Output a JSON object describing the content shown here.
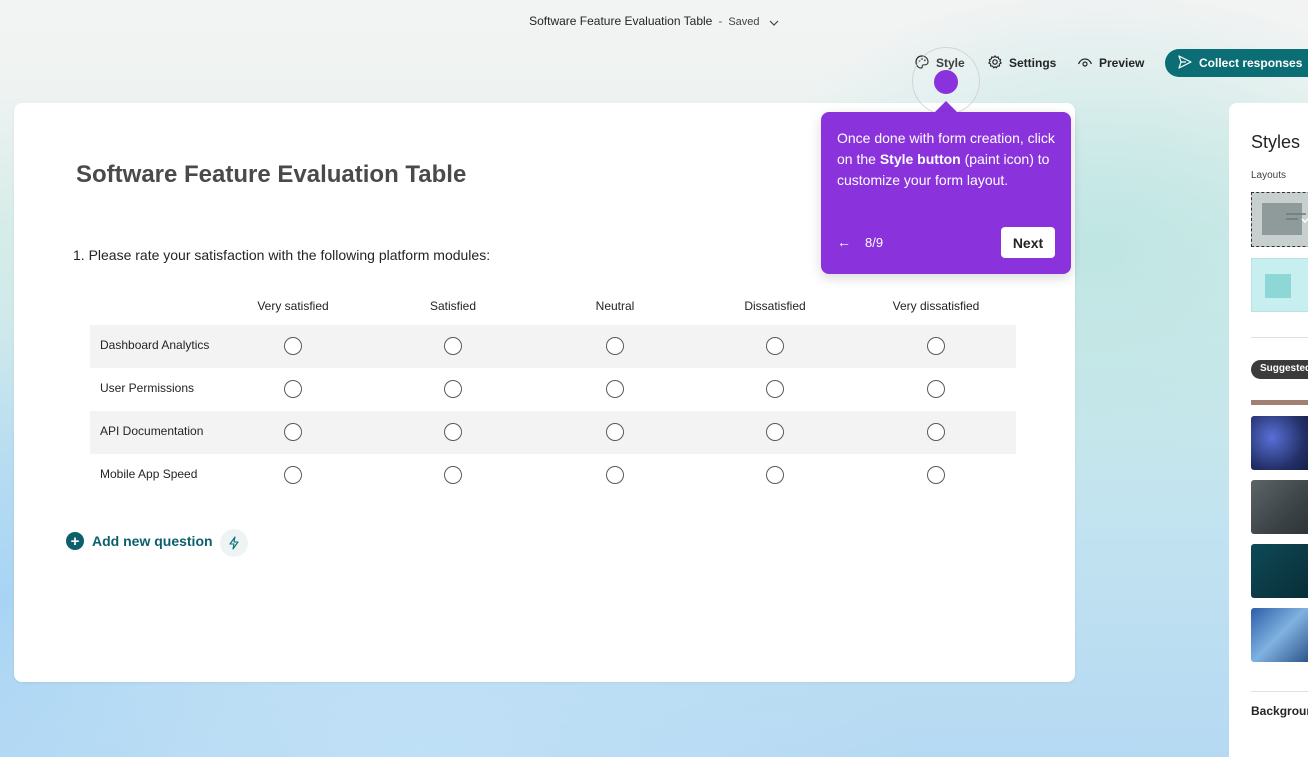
{
  "header": {
    "doc_title": "Software Feature Evaluation Table",
    "separator": "-",
    "status": "Saved"
  },
  "toolbar": {
    "style_label": "Style",
    "settings_label": "Settings",
    "preview_label": "Preview",
    "collect_label": "Collect responses"
  },
  "form": {
    "title": "Software Feature Evaluation Table",
    "question": "1. Please rate your satisfaction with the following platform modules:",
    "columns": [
      "Very satisfied",
      "Satisfied",
      "Neutral",
      "Dissatisfied",
      "Very dissatisfied"
    ],
    "rows": [
      "Dashboard Analytics",
      "User Permissions",
      "API Documentation",
      "Mobile App Speed"
    ],
    "add_question_label": "Add new question"
  },
  "tooltip": {
    "text_before": "Once done with form creation, click on the ",
    "text_bold": "Style button",
    "text_after": " (paint icon) to customize your form layout.",
    "back_arrow": "←",
    "step": "8/9",
    "next_label": "Next"
  },
  "styles_panel": {
    "title": "Styles",
    "layouts_label": "Layouts",
    "suggested_label": "Suggested",
    "background_label": "Background"
  },
  "colors": {
    "accent_teal": "#0c6e75",
    "tooltip_purple": "#8a33dd"
  }
}
